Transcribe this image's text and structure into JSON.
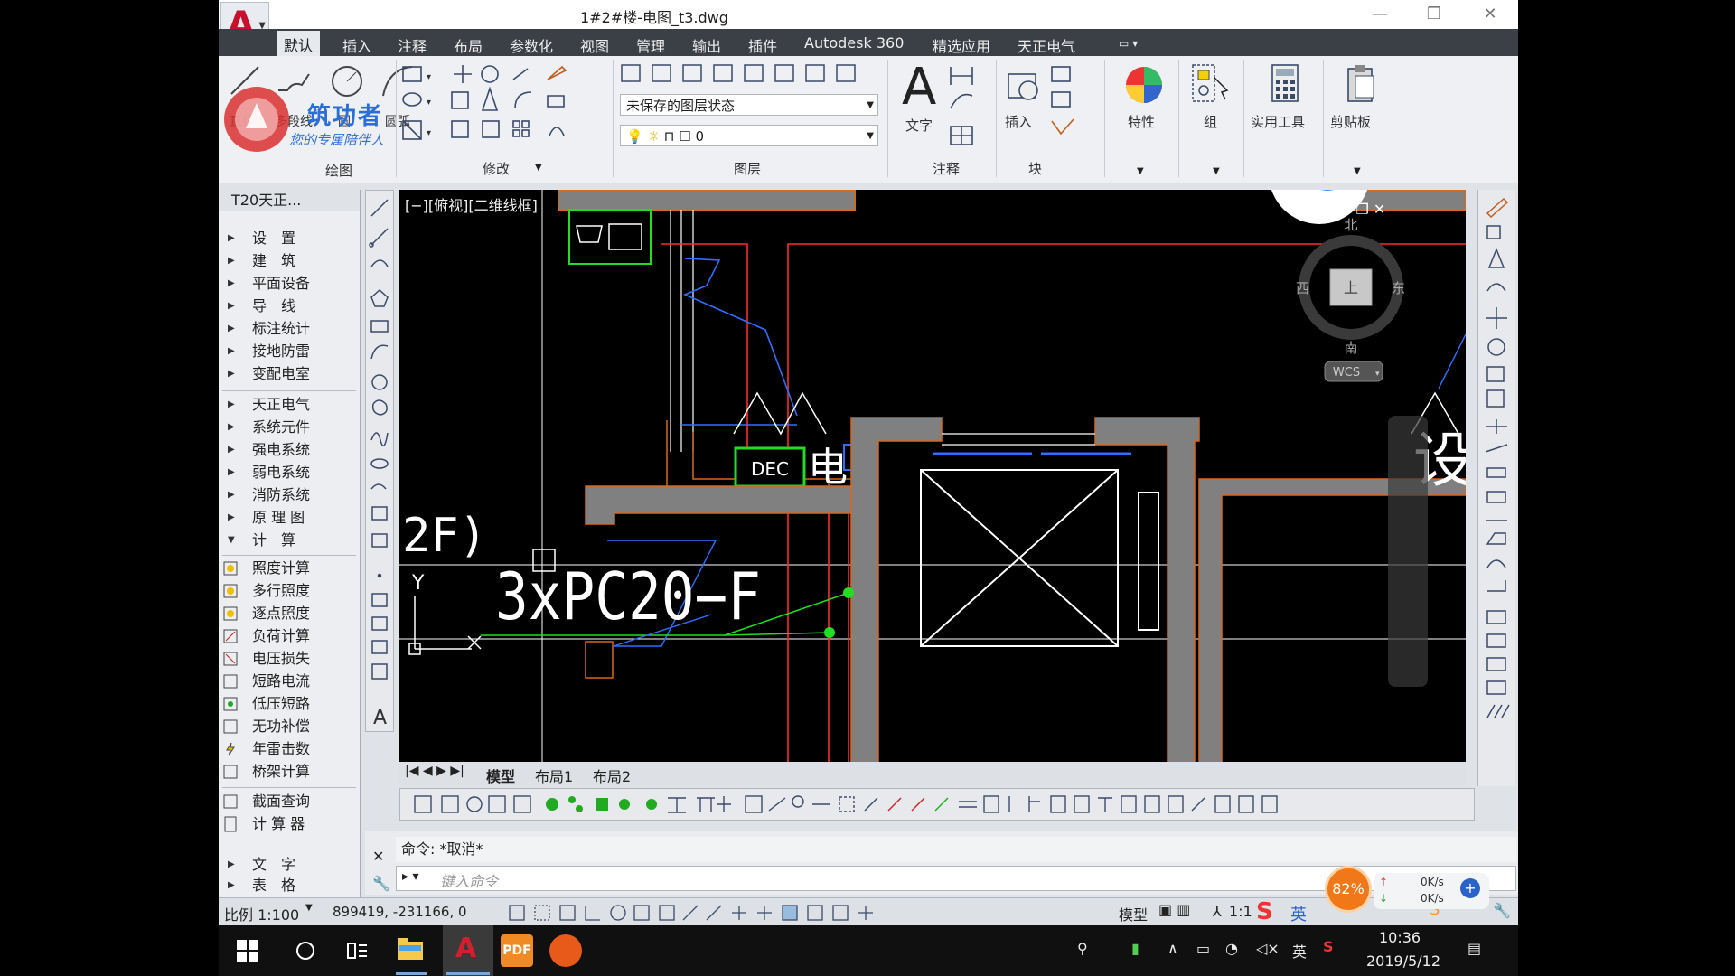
{
  "window": {
    "title": "1#2#楼-电图_t3.dwg",
    "minimize": "—",
    "restore": "❐",
    "close": "✕"
  },
  "menu_tabs": [
    "默认",
    "插入",
    "注释",
    "布局",
    "参数化",
    "视图",
    "管理",
    "输出",
    "插件",
    "Autodesk 360",
    "精选应用",
    "天正电气"
  ],
  "ribbon": {
    "draw_tools": [
      "直线",
      "多段线",
      "圆",
      "圆弧"
    ],
    "draw_panel_title": "绘图",
    "modify_panel_title": "修改",
    "layer_panel_title": "图层",
    "layer_state_value": "未保存的图层状态",
    "layer_current_value": "0",
    "annotation_panel_title": "注释",
    "text_label": "文字",
    "block_panel_title": "块",
    "insert_label": "插入",
    "properties_label": "特性",
    "group_label": "组",
    "utilities_label": "实用工具",
    "clipboard_label": "剪贴板"
  },
  "watermark": {
    "brand": "筑功者",
    "slogan": "您的专属陪伴人"
  },
  "palette": {
    "title": "T20天正...",
    "group1": [
      "设　置",
      "建　筑",
      "平面设备",
      "导　线",
      "标注统计",
      "接地防雷",
      "变配电室"
    ],
    "group2": [
      "天正电气",
      "系统元件",
      "强电系统",
      "弱电系统",
      "消防系统",
      "原 理 图",
      "计　算"
    ],
    "calc_items": [
      "照度计算",
      "多行照度",
      "逐点照度",
      "负荷计算",
      "电压损失",
      "短路电流",
      "低压短路",
      "无功补偿",
      "年雷击数",
      "桥架计算"
    ],
    "tools": [
      "截面查询",
      "计 算 器"
    ],
    "group3": [
      "文　字",
      "表　格"
    ]
  },
  "viewport": {
    "label": "[−][俯视][二维线框]",
    "compass": {
      "north": "北",
      "south": "南",
      "east": "东",
      "west": "西",
      "top": "上",
      "wcs": "WCS"
    },
    "dec_label": "DEC",
    "big_text": "3xPC20−F",
    "floor_text": "2F)",
    "side_char1": "电",
    "side_char2": "设",
    "ucs_y": "Y",
    "colors": {
      "wall": "#808080",
      "outline": "#d2691e",
      "red": "#ff2a2a",
      "blue": "#2f6fff",
      "green": "#22dd22",
      "white": "#ffffff"
    }
  },
  "layout_tabs": [
    "模型",
    "布局1",
    "布局2"
  ],
  "command": {
    "history": "命令: *取消*",
    "placeholder": "键入命令"
  },
  "status": {
    "scale": "比例 1:100",
    "coords": "899419, -231166, 0",
    "model": "模型",
    "annot_scale": "1:1"
  },
  "overlay": {
    "percent": "82%",
    "up_speed": "0K/s",
    "down_speed": "0K/s",
    "ime": "英"
  },
  "taskbar": {
    "time": "10:36",
    "date": "2019/5/12",
    "ime": "英"
  }
}
